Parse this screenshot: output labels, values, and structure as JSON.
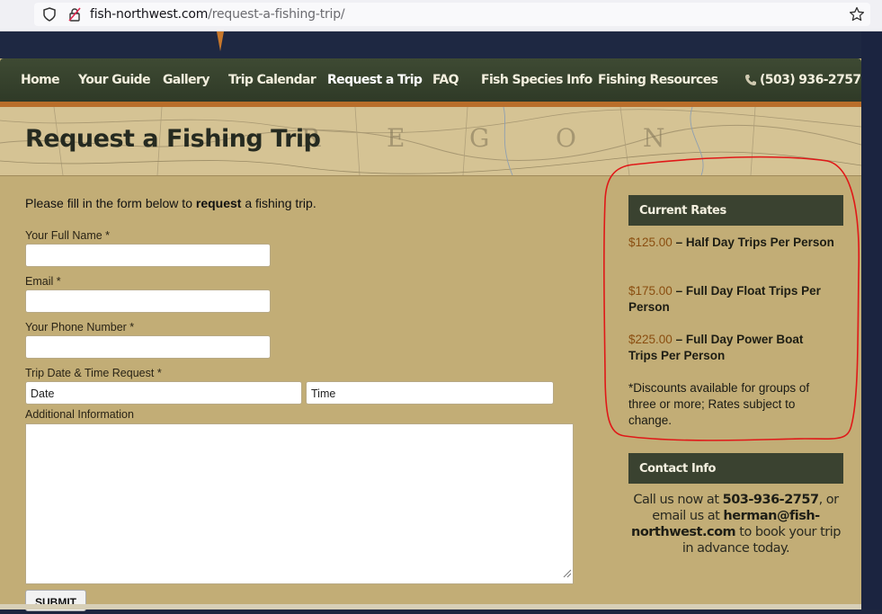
{
  "browser": {
    "url_host": "fish-northwest.com",
    "url_path": "/request-a-fishing-trip/"
  },
  "nav": {
    "items": [
      "Home",
      "Your Guide",
      "Gallery",
      "Trip Calendar",
      "Request a Trip",
      "FAQ",
      "Fish Species Info",
      "Fishing Resources"
    ],
    "active": "Request a Trip",
    "phone": "(503) 936-2757"
  },
  "banner": {
    "title": "Request a Fishing Trip",
    "map_letters": [
      "R",
      "E",
      "G",
      "O",
      "N"
    ]
  },
  "form": {
    "intro_before": "Please fill in the form below to ",
    "intro_bold": "request",
    "intro_after": " a fishing trip.",
    "name_label": "Your Full Name *",
    "email_label": "Email *",
    "phone_label": "Your Phone Number *",
    "date_label": "Trip Date & Time Request *",
    "date_placeholder": "Date",
    "time_placeholder": "Time",
    "info_label": "Additional Information",
    "submit_label": "SUBMIT"
  },
  "sidebar": {
    "rates_title": "Current Rates",
    "rates": [
      {
        "price": "$125.00",
        "desc": " – Half Day Trips Per Person"
      },
      {
        "price": "$175.00",
        "desc": " – Full Day Float Trips Per Person"
      },
      {
        "price": "$225.00",
        "desc": " – Full Day Power Boat Trips Per Person"
      }
    ],
    "discount_note": "*Discounts available for groups of three or more; Rates subject to change.",
    "contact_title": "Contact Info",
    "contact_line1": "Call us now at ",
    "contact_phone": "503-936-2757",
    "contact_line2": ", or email us at ",
    "contact_email": "herman@fish-northwest.com",
    "contact_line3": " to book your trip in advance today."
  },
  "colors": {
    "nav_bg": "#3e4a33",
    "page_bg": "#c2ad76",
    "accent_orange": "#b96e2a",
    "price_color": "#8a4e10",
    "annotation_red": "#e01818"
  }
}
